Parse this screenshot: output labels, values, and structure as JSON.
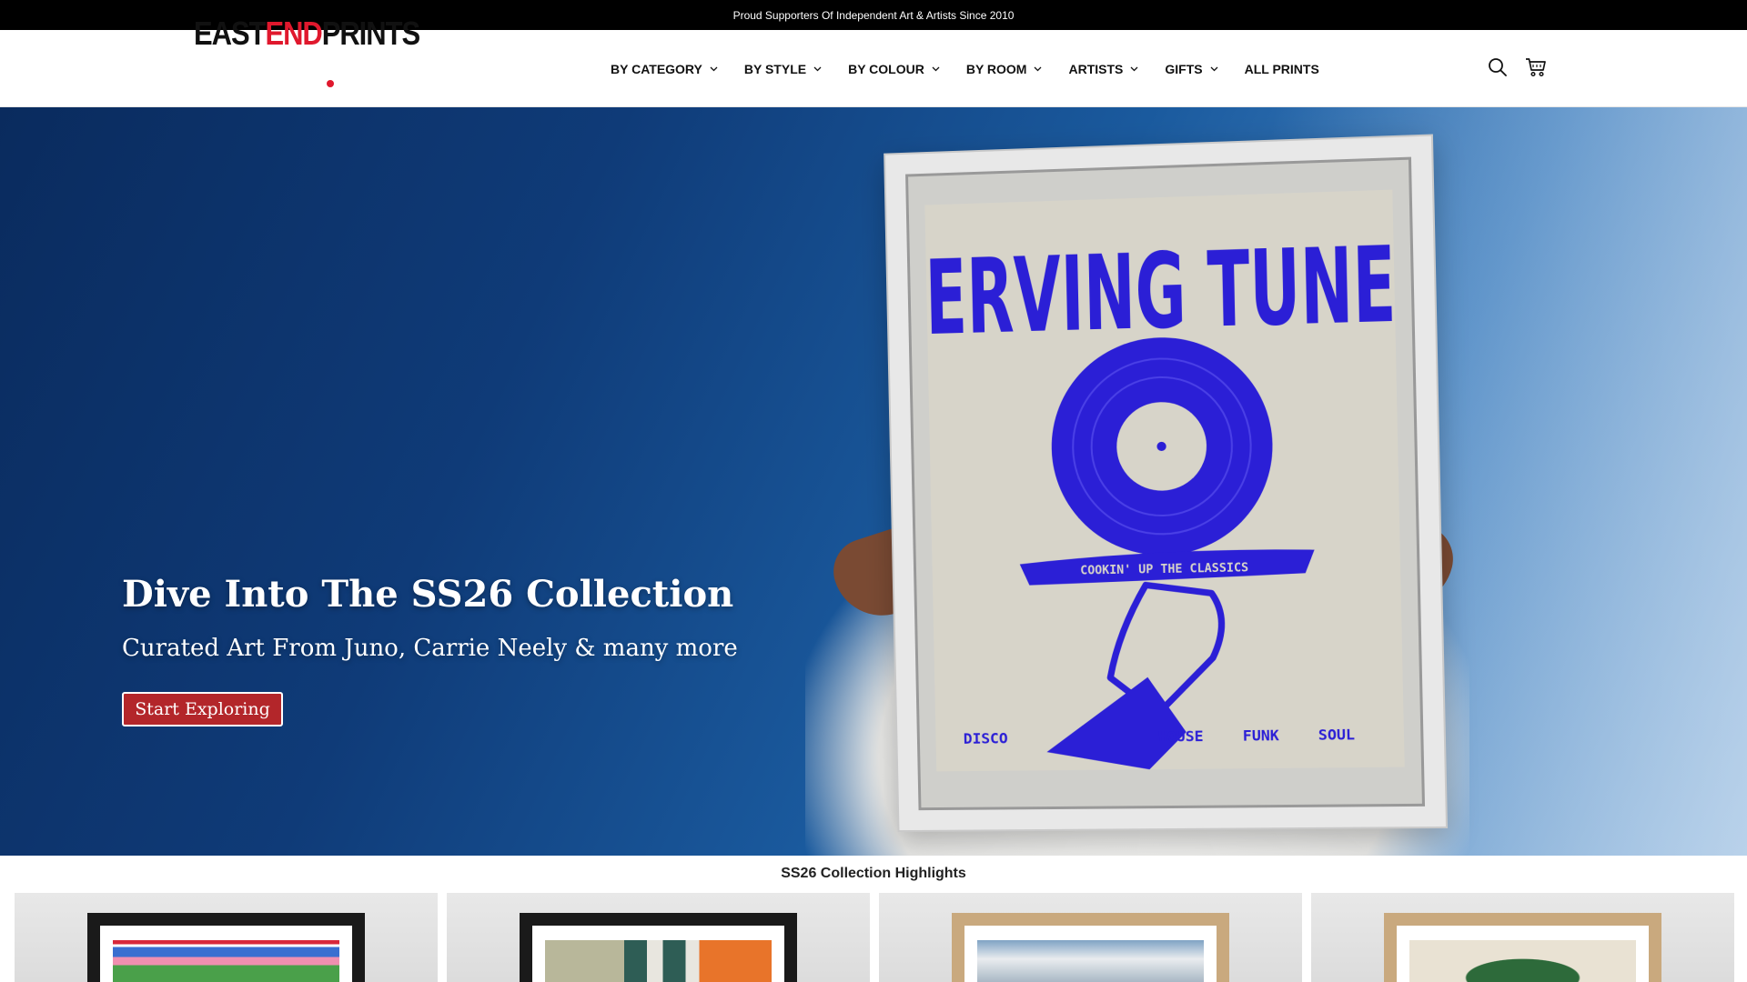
{
  "announcement": {
    "text": "Proud Supporters Of Independent Art & Artists Since 2010"
  },
  "brand": {
    "east": "EAST",
    "end": "END",
    "prints": "PRINTS",
    "accent_color": "#e0182d"
  },
  "nav": {
    "items": [
      {
        "label": "BY CATEGORY",
        "has_dropdown": true
      },
      {
        "label": "BY STYLE",
        "has_dropdown": true
      },
      {
        "label": "BY COLOUR",
        "has_dropdown": true
      },
      {
        "label": "BY ROOM",
        "has_dropdown": true
      },
      {
        "label": "ARTISTS",
        "has_dropdown": true
      },
      {
        "label": "GIFTS",
        "has_dropdown": true
      },
      {
        "label": "ALL PRINTS",
        "has_dropdown": false
      }
    ]
  },
  "header_icons": {
    "search": "search-icon",
    "cart": "cart-icon"
  },
  "hero": {
    "title": "Dive Into The SS26 Collection",
    "subtitle": "Curated Art From Juno, Carrie Neely & many more",
    "cta": "Start Exploring",
    "cta_color": "#b3262a",
    "poster": {
      "headline": "SERVING TUNES",
      "tray_text": "COOKIN' UP THE CLASSICS",
      "genres": [
        "DISCO",
        "HOUSE",
        "FUNK",
        "SOUL"
      ],
      "ink_color": "#2b1fd6"
    }
  },
  "highlights": {
    "title": "SS26 Collection Highlights",
    "cards": [
      {
        "frame": "black"
      },
      {
        "frame": "black"
      },
      {
        "frame": "oak"
      },
      {
        "frame": "oak"
      }
    ]
  }
}
